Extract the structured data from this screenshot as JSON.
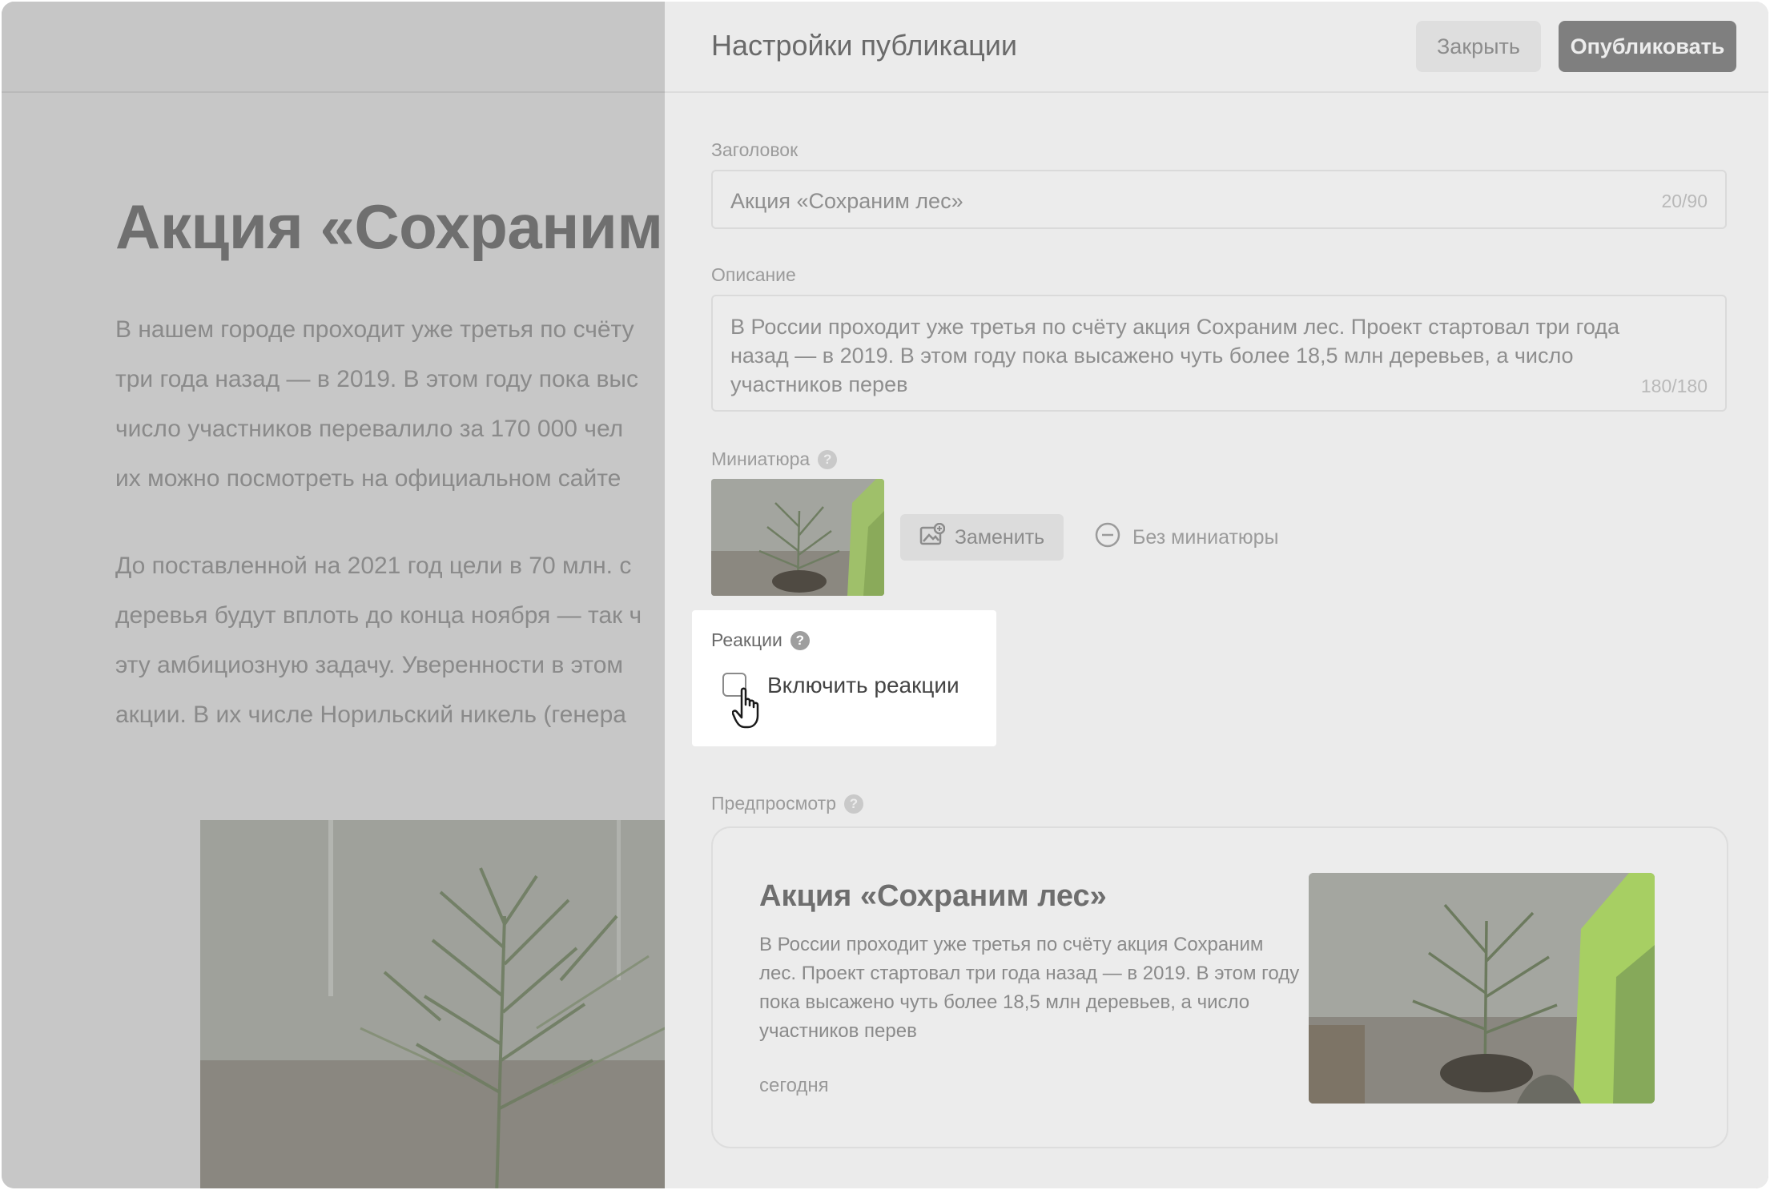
{
  "article": {
    "title": "Акция «Сохраним лес»",
    "paragraph1": [
      "В нашем городе проходит уже третья по счёту",
      "три года назад — в 2019. В этом году пока выс",
      "число участников перевалило за 170 000 чел",
      "их можно посмотреть на официальном сайте"
    ],
    "paragraph2": [
      "До поставленной на 2021 год цели в 70 млн. с",
      "деревья будут вплоть до конца ноября — так ч",
      "эту амбициозную задачу. Уверенности в этом",
      "акции. В их числе Норильский никель (генера"
    ]
  },
  "panel": {
    "title": "Настройки публикации",
    "close_label": "Закрыть",
    "publish_label": "Опубликовать"
  },
  "form": {
    "title_label": "Заголовок",
    "title_value": "Акция «Сохраним лес»",
    "title_counter": "20/90",
    "desc_label": "Описание",
    "desc_value": "В России проходит уже третья по счёту акция Сохраним лес. Проект стартовал три года назад — в 2019. В этом году пока высажено чуть более 18,5 млн деревьев, а число участников перев",
    "desc_counter": "180/180",
    "thumb_label": "Миниатюра",
    "replace_label": "Заменить",
    "no_thumb_label": "Без миниатюры",
    "reactions_label": "Реакции",
    "enable_reactions_label": "Включить реакции",
    "enable_reactions_checked": false,
    "help_glyph": "?"
  },
  "preview": {
    "label": "Предпросмотр",
    "title": "Акция «Сохраним лес»",
    "text": "В России проходит уже третья по счёту акция Сохраним лес. Проект стартовал три года назад — в 2019. В этом году пока высажено чуть более 18,5 млн деревьев, а число участников перев",
    "date": "сегодня"
  },
  "icons": {
    "help": "question-circle-icon",
    "replace": "image-replace-icon",
    "no_thumb": "minus-circle-icon",
    "cursor": "hand-pointer-cursor-icon"
  }
}
